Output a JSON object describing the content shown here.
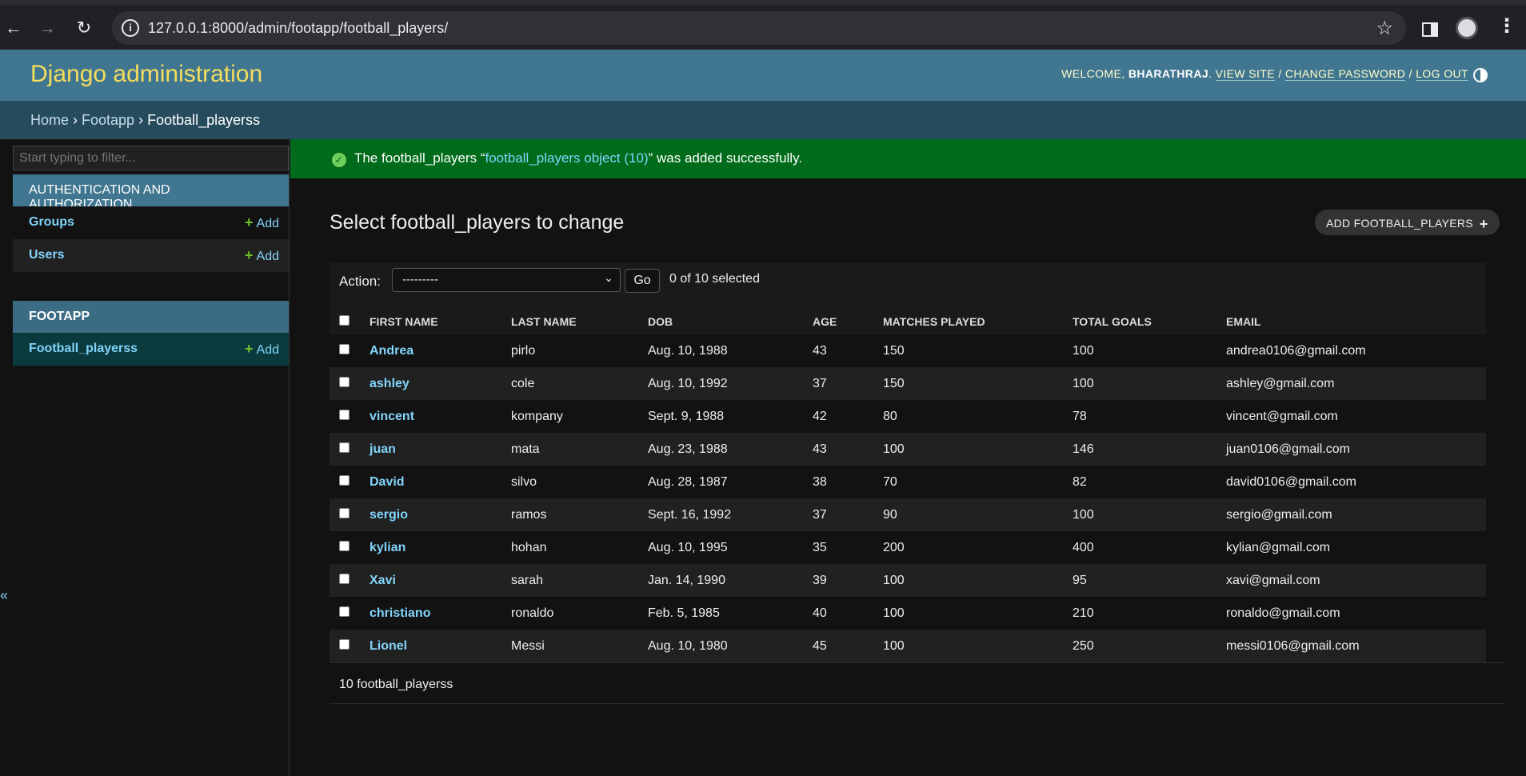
{
  "browser": {
    "url": "127.0.0.1:8000/admin/footapp/football_players/"
  },
  "header": {
    "site_title": "Django administration",
    "welcome_text": "WELCOME,",
    "username": "BHARATHRAJ",
    "view_site": "VIEW SITE",
    "change_password": "CHANGE PASSWORD",
    "log_out": "LOG OUT"
  },
  "breadcrumbs": {
    "home": "Home",
    "app": "Footapp",
    "current": "Football_playerss"
  },
  "sidebar": {
    "filter_placeholder": "Start typing to filter...",
    "auth_caption": "Authentication and Authorization",
    "groups_label": "Groups",
    "users_label": "Users",
    "footapp_caption": "FOOTAPP",
    "football_playerss_label": "Football_playerss",
    "add_label": "Add"
  },
  "message": {
    "prefix": "The football_players “",
    "link": "football_players object (10)",
    "suffix": "” was added successfully."
  },
  "content": {
    "title": "Select football_players to change",
    "add_button": "ADD FOOTBALL_PLAYERS",
    "action_label": "Action:",
    "action_selected": "---------",
    "go_label": "Go",
    "selected_count": "0 of 10 selected",
    "footer_count": "10 football_playerss"
  },
  "table": {
    "columns": [
      "FIRST NAME",
      "LAST NAME",
      "DOB",
      "AGE",
      "MATCHES PLAYED",
      "TOTAL GOALS",
      "EMAIL"
    ],
    "rows": [
      [
        "Andrea",
        "pirlo",
        "Aug. 10, 1988",
        "43",
        "150",
        "100",
        "andrea0106@gmail.com"
      ],
      [
        "ashley",
        "cole",
        "Aug. 10, 1992",
        "37",
        "150",
        "100",
        "ashley@gmail.com"
      ],
      [
        "vincent",
        "kompany",
        "Sept. 9, 1988",
        "42",
        "80",
        "78",
        "vincent@gmail.com"
      ],
      [
        "juan",
        "mata",
        "Aug. 23, 1988",
        "43",
        "100",
        "146",
        "juan0106@gmail.com"
      ],
      [
        "David",
        "silvo",
        "Aug. 28, 1987",
        "38",
        "70",
        "82",
        "david0106@gmail.com"
      ],
      [
        "sergio",
        "ramos",
        "Sept. 16, 1992",
        "37",
        "90",
        "100",
        "sergio@gmail.com"
      ],
      [
        "kylian",
        "hohan",
        "Aug. 10, 1995",
        "35",
        "200",
        "400",
        "kylian@gmail.com"
      ],
      [
        "Xavi",
        "sarah",
        "Jan. 14, 1990",
        "39",
        "100",
        "95",
        "xavi@gmail.com"
      ],
      [
        "christiano",
        "ronaldo",
        "Feb. 5, 1985",
        "40",
        "100",
        "210",
        "ronaldo@gmail.com"
      ],
      [
        "Lionel",
        "Messi",
        "Aug. 10, 1980",
        "45",
        "100",
        "250",
        "messi0106@gmail.com"
      ]
    ]
  },
  "colors": {
    "header_bg": "#417690",
    "site_title": "#f5dd5d",
    "breadcrumbs_bg": "#264b5d",
    "success_bg": "#006b1b",
    "link": "#81d4fa",
    "add_plus": "#70bf2b"
  }
}
